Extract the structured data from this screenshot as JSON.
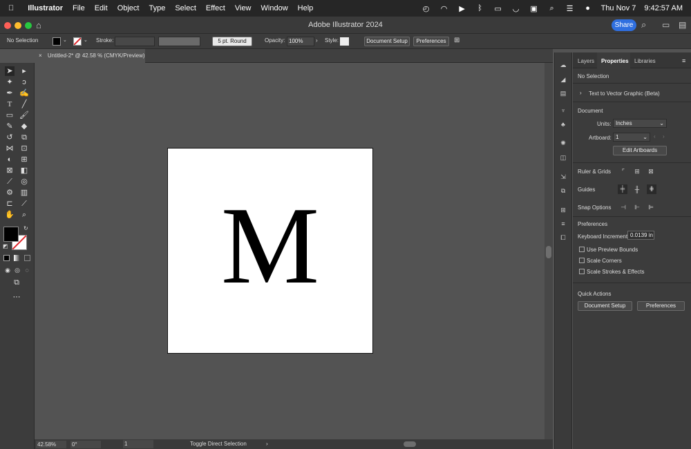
{
  "menubar": {
    "app": "Illustrator",
    "items": [
      "File",
      "Edit",
      "Object",
      "Type",
      "Select",
      "Effect",
      "View",
      "Window",
      "Help"
    ],
    "date": "Thu Nov 7",
    "time": "9:42:57 AM"
  },
  "window": {
    "title": "Adobe Illustrator 2024",
    "share": "Share"
  },
  "control": {
    "selection": "No Selection",
    "stroke_label": "Stroke:",
    "brush": "5 pt. Round",
    "opacity_label": "Opacity:",
    "opacity": "100%",
    "style_label": "Style:",
    "doc_setup": "Document Setup",
    "preferences": "Preferences"
  },
  "document": {
    "tab": "Untitled-2* @ 42.58 % (CMYK/Preview)",
    "glyph": "M"
  },
  "status": {
    "zoom": "42.58%",
    "rotation": "0°",
    "artboard": "1",
    "tool": "Toggle Direct Selection"
  },
  "panel": {
    "tabs": [
      "Layers",
      "Properties",
      "Libraries"
    ],
    "no_selection": "No Selection",
    "text_to_vector": "Text to Vector Graphic (Beta)",
    "document": "Document",
    "units_label": "Units:",
    "units": "Inches",
    "artboard_label": "Artboard:",
    "artboard": "1",
    "edit_artboards": "Edit Artboards",
    "ruler_grids": "Ruler & Grids",
    "guides": "Guides",
    "snap_options": "Snap Options",
    "preferences": "Preferences",
    "keyboard_increment_label": "Keyboard Increment:",
    "keyboard_increment": "0.0139 in",
    "use_preview_bounds": "Use Preview Bounds",
    "scale_corners": "Scale Corners",
    "scale_strokes": "Scale Strokes & Effects",
    "quick_actions": "Quick Actions",
    "qa_doc_setup": "Document Setup",
    "qa_preferences": "Preferences"
  }
}
